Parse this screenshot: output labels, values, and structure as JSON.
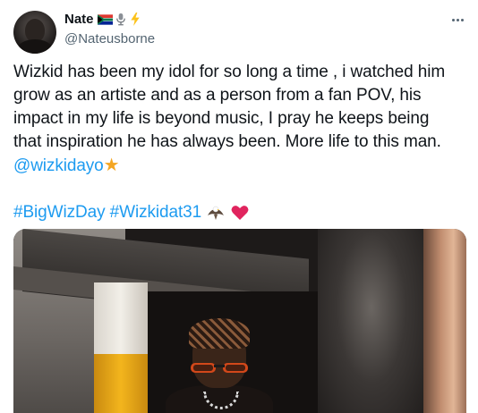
{
  "user": {
    "display_name": "Nate",
    "handle": "@Nateusborne",
    "name_icons": [
      "south-africa-flag-icon",
      "microphone-icon",
      "lightning-bolt-icon"
    ]
  },
  "tweet": {
    "line1": "Wizkid has been my idol for so long a time , i watched him",
    "line2": "grow as an artiste and as a person from a fan POV, his",
    "line3": "impact in my life is beyond music, I pray he keeps being",
    "line4": "that inspiration he has always been. More life to this man.",
    "mention": "@wizkidayo",
    "mention_emoji": "star-icon",
    "hashtag1": "#BigWizDay",
    "hashtag2": "#Wizkidat31",
    "tag_emojis": [
      "eagle-icon",
      "heart-icon"
    ]
  },
  "colors": {
    "link": "#1d9bf0",
    "secondary_text": "#536471",
    "primary_text": "#0f1419",
    "star": "#f4a623",
    "heart": "#e0245e"
  },
  "media": {
    "kind": "photo",
    "subject": "person-photo"
  }
}
